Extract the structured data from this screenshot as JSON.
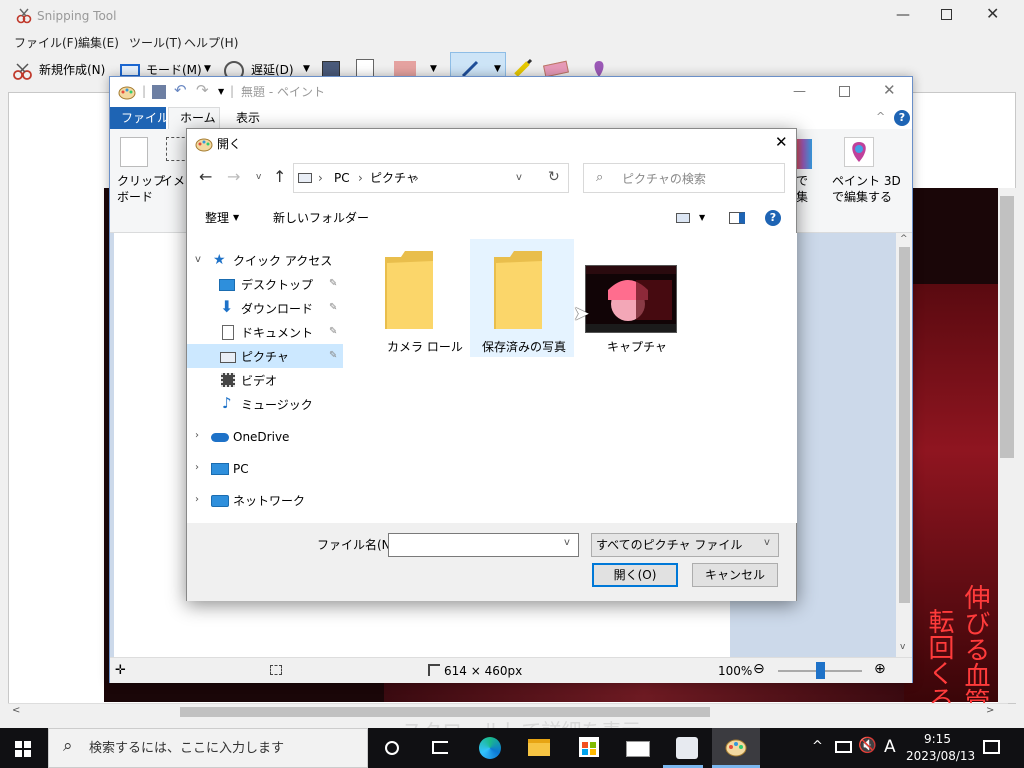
{
  "snipping_tool": {
    "title": "Snipping Tool",
    "menu": [
      "ファイル(F)",
      "編集(E)",
      "ツール(T)",
      "ヘルプ(H)"
    ],
    "toolbar": {
      "new": "新規作成(N)",
      "mode": "モード(M)",
      "delay": "遅延(D)"
    },
    "overlay_text": "スクロールして詳細を表示",
    "side_text_1": "伸びる血管",
    "side_text_2": "転回くる"
  },
  "paint": {
    "title": "無題 - ペイント",
    "tabs": [
      "ファイル",
      "ホーム",
      "表示"
    ],
    "ribbon": {
      "clipboard_1": "クリップ",
      "clipboard_2": "ボード",
      "image": "イメー",
      "edit_1": "で",
      "edit_2": "集",
      "paint3d_1": "ペイント 3D",
      "paint3d_2": "で編集する"
    },
    "status": {
      "size": "614 × 460px",
      "zoom": "100%"
    }
  },
  "open_dialog": {
    "title": "開く",
    "breadcrumb": [
      "PC",
      "ピクチャ"
    ],
    "search_placeholder": "ピクチャの検索",
    "organize": "整理",
    "new_folder": "新しいフォルダー",
    "nav": {
      "quick_access": "クイック アクセス",
      "items": [
        "デスクトップ",
        "ダウンロード",
        "ドキュメント",
        "ピクチャ",
        "ビデオ",
        "ミュージック"
      ],
      "onedrive": "OneDrive",
      "pc": "PC",
      "network": "ネットワーク"
    },
    "files": [
      "カメラ ロール",
      "保存済みの写真",
      "キャプチャ"
    ],
    "filename_label": "ファイル名(N):",
    "filename_value": "",
    "filter": "すべてのピクチャ ファイル",
    "open_button": "開く(O)",
    "cancel_button": "キャンセル"
  },
  "taskbar": {
    "search_placeholder": "検索するには、ここに入力します",
    "ime": "A",
    "time": "9:15",
    "date": "2023/08/13"
  }
}
